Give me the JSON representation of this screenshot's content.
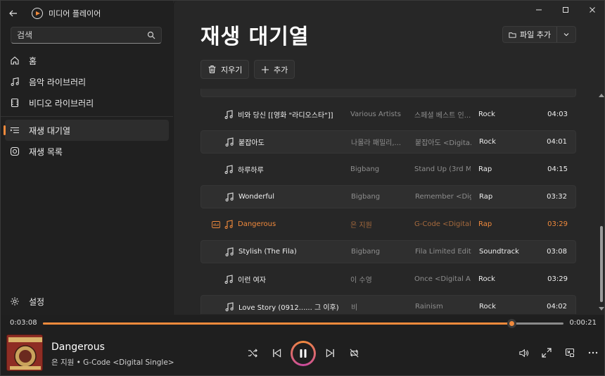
{
  "app": {
    "title": "미디어 플레이어"
  },
  "search": {
    "placeholder": "검색"
  },
  "sidebar": {
    "items": [
      {
        "label": "홈",
        "icon": "home-icon"
      },
      {
        "label": "음악 라이브러리",
        "icon": "music-note-icon"
      },
      {
        "label": "비디오 라이브러리",
        "icon": "film-icon"
      },
      {
        "label": "재생 대기열",
        "icon": "queue-icon",
        "active": true
      },
      {
        "label": "재생 목록",
        "icon": "playlist-icon"
      }
    ],
    "settings_label": "설정"
  },
  "main": {
    "title": "재생 대기열",
    "add_file_label": "파일 추가",
    "clear_label": "지우기",
    "add_label": "추가"
  },
  "queue": [
    {
      "title": "비와 당신 [[영화 \"라디오스타\"]]",
      "artist": "Various Artists",
      "album": "스페셜 베스트 인...",
      "genre": "Rock",
      "time": "04:03",
      "shade": false,
      "active": false
    },
    {
      "title": "붙잡아도",
      "artist": "나몰라 패밀리,...",
      "album": "붙잡아도 <Digita...",
      "genre": "Rock",
      "time": "04:01",
      "shade": true,
      "active": false
    },
    {
      "title": "하루하루",
      "artist": "Bigbang",
      "album": "Stand Up (3rd M...",
      "genre": "Rap",
      "time": "04:15",
      "shade": false,
      "active": false
    },
    {
      "title": "Wonderful",
      "artist": "Bigbang",
      "album": "Remember <Dig...",
      "genre": "Rap",
      "time": "03:32",
      "shade": true,
      "active": false
    },
    {
      "title": "Dangerous",
      "artist": "은 지원",
      "album": "G-Code <Digital...",
      "genre": "Rap",
      "time": "03:29",
      "shade": false,
      "active": true
    },
    {
      "title": "Stylish (The Fila)",
      "artist": "Bigbang",
      "album": "Fila Limited Editi...",
      "genre": "Soundtrack",
      "time": "03:08",
      "shade": true,
      "active": false
    },
    {
      "title": "이런 여자",
      "artist": "이 수영",
      "album": "Once <Digital Al...",
      "genre": "Rock",
      "time": "03:29",
      "shade": false,
      "active": false
    },
    {
      "title": "Love Story (0912...... 그 이후)",
      "artist": "비",
      "album": "Rainism",
      "genre": "Rock",
      "time": "04:02",
      "shade": true,
      "active": false
    }
  ],
  "player": {
    "elapsed": "0:03:08",
    "remaining": "0:00:21",
    "progress": 0.9,
    "now_playing_title": "Dangerous",
    "now_playing_subtitle": "은 지원 • G-Code <Digital Single>"
  },
  "colors": {
    "accent": "#f18a3c"
  }
}
